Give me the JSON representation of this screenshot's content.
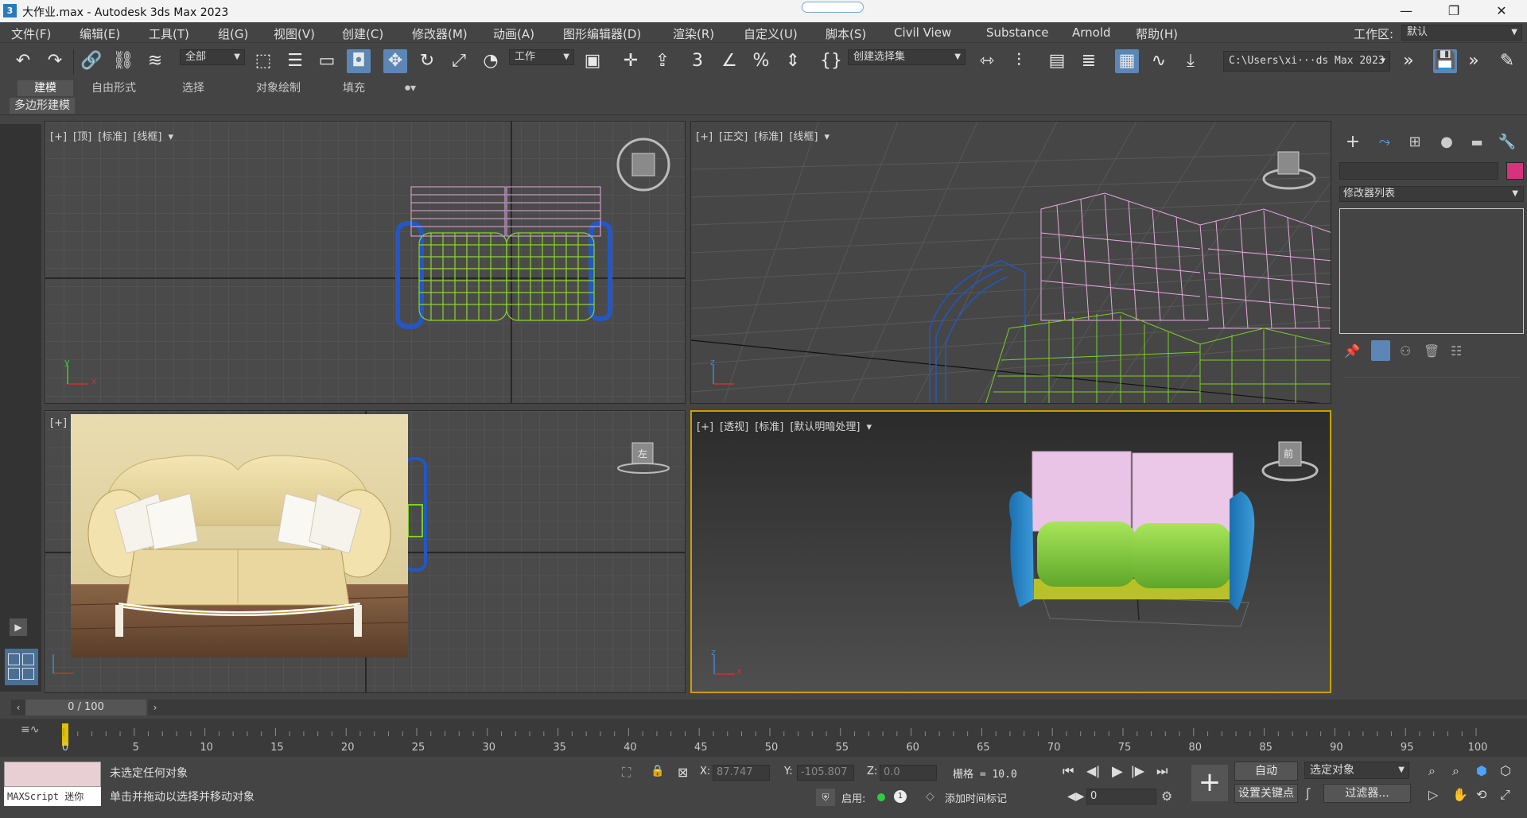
{
  "window": {
    "title": "大作业.max - Autodesk 3ds Max 2023",
    "app_icon": "3",
    "minimize_icon": "—",
    "maximize_icon": "❐",
    "close_icon": "✕"
  },
  "menu": {
    "items": [
      "文件(F)",
      "编辑(E)",
      "工具(T)",
      "组(G)",
      "视图(V)",
      "创建(C)",
      "修改器(M)",
      "动画(A)",
      "图形编辑器(D)",
      "渲染(R)",
      "自定义(U)",
      "脚本(S)",
      "Civil View",
      "Substance",
      "Arnold",
      "帮助(H)"
    ],
    "workspace_label": "工作区:",
    "workspace_value": "默认"
  },
  "toolbar": {
    "selection_filter": "全部",
    "coord_system": "工作",
    "named_selection": "创建选择集",
    "project_path": "C:\\Users\\xi···ds Max 2023",
    "snap_3": "3",
    "percent": "%"
  },
  "ribbon": {
    "tabs": [
      "建模",
      "自由形式",
      "选择",
      "对象绘制",
      "填充"
    ],
    "sub_tab": "多边形建模"
  },
  "viewports": {
    "top": {
      "labels": [
        "[+]",
        "[顶]",
        "[标准]",
        "[线框]"
      ]
    },
    "front": {
      "labels": [
        "[+]",
        "[正交]",
        "[标准]",
        "[线框]"
      ]
    },
    "left": {
      "labels": [
        "[+]"
      ],
      "cube_label": "左"
    },
    "perspective": {
      "labels": [
        "[+]",
        "[透视]",
        "[标准]",
        "[默认明暗处理]"
      ],
      "cube_label": "前"
    },
    "axis_x": "x",
    "axis_y": "y",
    "axis_z": "z"
  },
  "command_panel": {
    "modifier_list": "修改器列表",
    "object_color": "#d6337c"
  },
  "timeline": {
    "frame_display": "0 / 100",
    "ticks": [
      "0",
      "5",
      "10",
      "15",
      "20",
      "25",
      "30",
      "35",
      "40",
      "45",
      "50",
      "55",
      "60",
      "65",
      "70",
      "75",
      "80",
      "85",
      "90",
      "95",
      "100"
    ]
  },
  "status": {
    "maxscript_label": "MAXScript 迷你",
    "line1": "未选定任何对象",
    "line2": "单击并拖动以选择并移动对象",
    "x_label": "X:",
    "x_value": "87.747",
    "y_label": "Y:",
    "y_value": "-105.807",
    "z_label": "Z:",
    "z_value": "0.0",
    "grid": "栅格 = 10.0",
    "enable_label": "启用:",
    "add_time_tag": "添加时间标记",
    "auto_key": "自动",
    "set_key": "设置关键点",
    "key_filter_dd": "选定对象",
    "filters": "过滤器...",
    "frame_field": "0"
  },
  "colors": {
    "accent": "#5b86b5",
    "viewport_bg": "#4a4a4a",
    "active_border": "#c8a000"
  }
}
